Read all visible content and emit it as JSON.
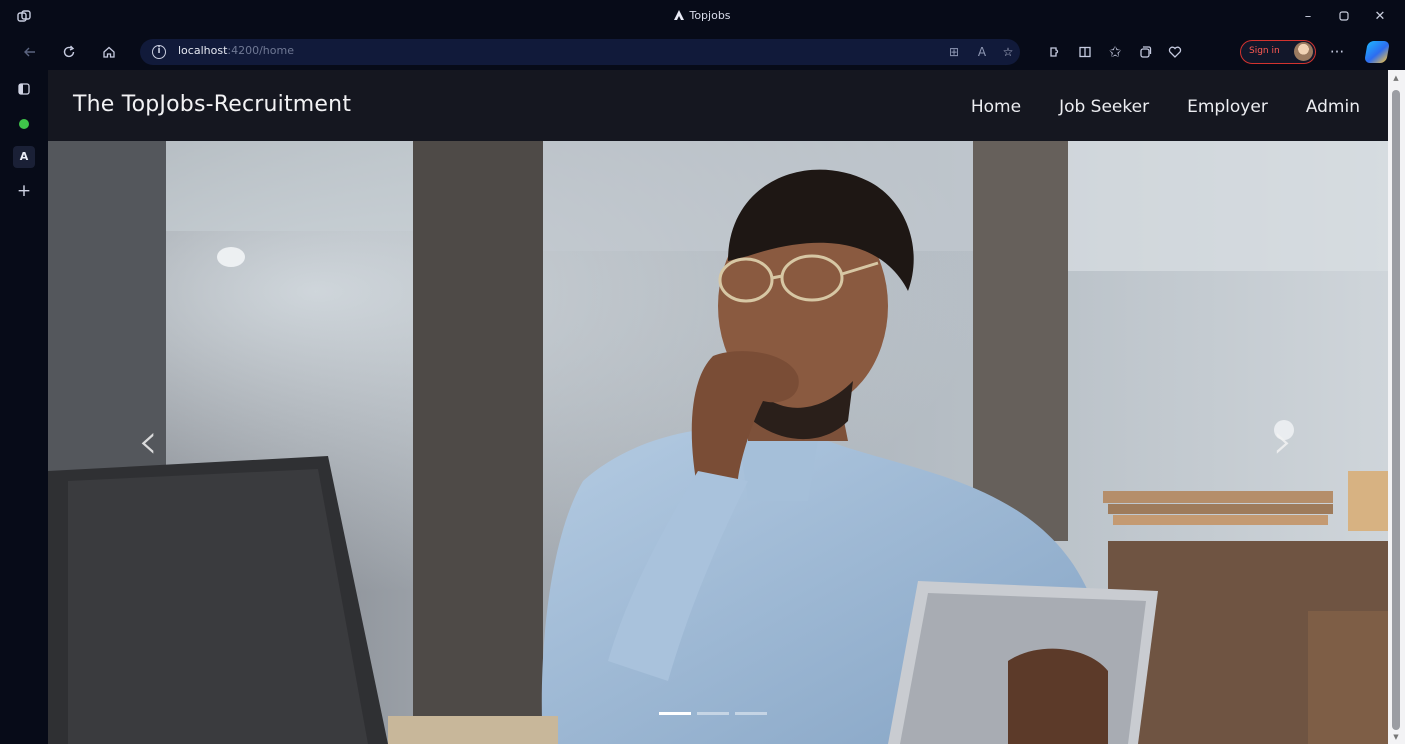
{
  "browser": {
    "window_title": "Topjobs",
    "url_host": "localhost",
    "url_path": ":4200/home",
    "sign_in_label": "Sign in",
    "controls": {
      "minimize": "–",
      "maximize": "▢",
      "close": "✕"
    }
  },
  "site": {
    "brand": "The TopJobs-Recruitment",
    "nav": [
      "Home",
      "Job Seeker",
      "Employer",
      "Admin"
    ]
  },
  "carousel": {
    "prev_glyph": "‹",
    "next_glyph": "›",
    "slide_count": 3,
    "active_slide": 1
  },
  "icons": {
    "titlebar": "workspaces-icon",
    "back": "back-arrow-icon",
    "reload": "reload-icon",
    "home": "home-icon",
    "info": "site-info-icon",
    "extensions": "extensions-icon",
    "favorites": "favorites-icon",
    "collections": "collections-icon"
  },
  "colors": {
    "browser_chrome": "#070b18",
    "address_bar": "#111a3a",
    "navbar": "#151720",
    "sign_in_accent": "#d2332f"
  }
}
